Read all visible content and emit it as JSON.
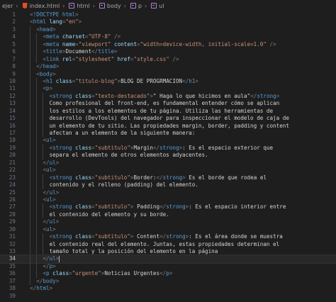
{
  "breadcrumb": {
    "items": [
      {
        "label": "ejer",
        "icon": "folder"
      },
      {
        "label": "index.html",
        "icon": "html-file-icon"
      },
      {
        "label": "html",
        "icon": "tag-icon"
      },
      {
        "label": "body",
        "icon": "tag-icon"
      },
      {
        "label": "p",
        "icon": "tag-icon"
      },
      {
        "label": "ul",
        "icon": "tag-icon"
      }
    ]
  },
  "editor": {
    "active_line": 34,
    "colors": {
      "tag": "#569cd6",
      "attr": "#9cdcfe",
      "string": "#ce9178",
      "text": "#d4d4d4",
      "punctuation": "#808080",
      "background": "#1e1e1e"
    },
    "lines": [
      {
        "n": "1",
        "indent": 1,
        "tokens": [
          [
            "p",
            "<"
          ],
          [
            "tag",
            "!DOCTYPE"
          ],
          [
            "tag",
            " html"
          ],
          [
            "p",
            ">"
          ]
        ]
      },
      {
        "n": "2",
        "indent": 1,
        "tokens": [
          [
            "p",
            "<"
          ],
          [
            "tag",
            "html"
          ],
          [
            "attr",
            " lang"
          ],
          [
            "p",
            "="
          ],
          [
            "str",
            "\"en\""
          ],
          [
            "p",
            ">"
          ]
        ]
      },
      {
        "n": "3",
        "indent": 2,
        "tokens": [
          [
            "p",
            "<"
          ],
          [
            "tag",
            "head"
          ],
          [
            "p",
            ">"
          ]
        ]
      },
      {
        "n": "4",
        "indent": 3,
        "tokens": [
          [
            "p",
            "<"
          ],
          [
            "tag",
            "meta"
          ],
          [
            "attr",
            " charset"
          ],
          [
            "p",
            "="
          ],
          [
            "str",
            "\"UTF-8\""
          ],
          [
            "p",
            " />"
          ]
        ]
      },
      {
        "n": "5",
        "indent": 3,
        "tokens": [
          [
            "p",
            "<"
          ],
          [
            "tag",
            "meta"
          ],
          [
            "attr",
            " name"
          ],
          [
            "p",
            "="
          ],
          [
            "str",
            "\"viewport\""
          ],
          [
            "attr",
            " content"
          ],
          [
            "p",
            "="
          ],
          [
            "str",
            "\"width=device-width, initial-scale=1.0\""
          ],
          [
            "p",
            " />"
          ]
        ]
      },
      {
        "n": "6",
        "indent": 3,
        "tokens": [
          [
            "p",
            "<"
          ],
          [
            "tag",
            "title"
          ],
          [
            "p",
            ">"
          ],
          [
            "text",
            "Document"
          ],
          [
            "p",
            "</"
          ],
          [
            "tag",
            "title"
          ],
          [
            "p",
            ">"
          ]
        ]
      },
      {
        "n": "7",
        "indent": 3,
        "tokens": [
          [
            "p",
            "<"
          ],
          [
            "tag",
            "link"
          ],
          [
            "attr",
            " rel"
          ],
          [
            "p",
            "="
          ],
          [
            "str",
            "\"stylesheet\""
          ],
          [
            "attr",
            " href"
          ],
          [
            "p",
            "="
          ],
          [
            "str",
            "\"style.css\""
          ],
          [
            "p",
            " />"
          ]
        ]
      },
      {
        "n": "8",
        "indent": 2,
        "tokens": [
          [
            "p",
            "</"
          ],
          [
            "tag",
            "head"
          ],
          [
            "p",
            ">"
          ]
        ]
      },
      {
        "n": "9",
        "indent": 2,
        "tokens": [
          [
            "p",
            "<"
          ],
          [
            "tag",
            "body"
          ],
          [
            "p",
            ">"
          ]
        ]
      },
      {
        "n": "10",
        "indent": 3,
        "tokens": [
          [
            "p",
            "<"
          ],
          [
            "tag",
            "h1"
          ],
          [
            "attr",
            " class"
          ],
          [
            "p",
            "="
          ],
          [
            "str",
            "\"titulo-blog\""
          ],
          [
            "p",
            ">"
          ],
          [
            "text",
            "BLOG DE PROGRMACION"
          ],
          [
            "p",
            "</"
          ],
          [
            "tag",
            "h1"
          ],
          [
            "p",
            ">"
          ]
        ]
      },
      {
        "n": "11",
        "indent": 3,
        "tokens": [
          [
            "p",
            "<"
          ],
          [
            "tag",
            "p"
          ],
          [
            "p",
            ">"
          ]
        ]
      },
      {
        "n": "12",
        "indent": 4,
        "tokens": [
          [
            "p",
            "<"
          ],
          [
            "tag",
            "strong"
          ],
          [
            "attr",
            " class"
          ],
          [
            "p",
            "="
          ],
          [
            "str",
            "\"texto-destacado\""
          ],
          [
            "p",
            ">"
          ],
          [
            "text",
            "\" Haga lo que hicimos en aula\""
          ],
          [
            "p",
            "</"
          ],
          [
            "tag",
            "strong"
          ],
          [
            "p",
            ">"
          ]
        ]
      },
      {
        "n": "13",
        "indent": 4,
        "tokens": [
          [
            "text",
            "Como profesional del front-end, es fundamental entender cómo se aplican"
          ]
        ]
      },
      {
        "n": "14",
        "indent": 4,
        "tokens": [
          [
            "text",
            "los estilos a los elementos de tu página. Utiliza las herramientas de"
          ]
        ]
      },
      {
        "n": "15",
        "indent": 4,
        "tokens": [
          [
            "text",
            "desarrollo (DevTools) del navegador para inspeccionar el modelo de caja de"
          ]
        ]
      },
      {
        "n": "16",
        "indent": 4,
        "tokens": [
          [
            "text",
            "un elemento de tu sitio. Las propiedades margin, border, padding y content"
          ]
        ]
      },
      {
        "n": "17",
        "indent": 4,
        "tokens": [
          [
            "text",
            "afectan a un elemento de la siguiente manera:"
          ]
        ]
      },
      {
        "n": "18",
        "indent": 3,
        "tokens": [
          [
            "p",
            "<"
          ],
          [
            "tag",
            "ul"
          ],
          [
            "p",
            ">"
          ]
        ]
      },
      {
        "n": "19",
        "indent": 4,
        "tokens": [
          [
            "p",
            "<"
          ],
          [
            "tag",
            "strong"
          ],
          [
            "attr",
            " class"
          ],
          [
            "p",
            "="
          ],
          [
            "str",
            "\"subtitulo\""
          ],
          [
            "p",
            ">"
          ],
          [
            "text",
            "Margin"
          ],
          [
            "p",
            "</"
          ],
          [
            "tag",
            "strong"
          ],
          [
            "p",
            ">"
          ],
          [
            "text",
            ": Es el espacio exterior que"
          ]
        ]
      },
      {
        "n": "20",
        "indent": 4,
        "tokens": [
          [
            "text",
            "separa el elemento de otros elementos adyacentes."
          ]
        ]
      },
      {
        "n": "21",
        "indent": 3,
        "tokens": [
          [
            "p",
            "</"
          ],
          [
            "tag",
            "ul"
          ],
          [
            "p",
            ">"
          ]
        ]
      },
      {
        "n": "22",
        "indent": 3,
        "tokens": [
          [
            "p",
            "<"
          ],
          [
            "tag",
            "ul"
          ],
          [
            "p",
            ">"
          ]
        ]
      },
      {
        "n": "23",
        "indent": 4,
        "tokens": [
          [
            "p",
            "<"
          ],
          [
            "tag",
            "strong"
          ],
          [
            "attr",
            " class"
          ],
          [
            "p",
            "="
          ],
          [
            "str",
            "\"subtitulo\""
          ],
          [
            "p",
            ">"
          ],
          [
            "text",
            "Border:"
          ],
          [
            "p",
            "</"
          ],
          [
            "tag",
            "strong"
          ],
          [
            "p",
            ">"
          ],
          [
            "text",
            " Es el borde que rodea el"
          ]
        ]
      },
      {
        "n": "24",
        "indent": 4,
        "tokens": [
          [
            "text",
            "contenido y el relleno (padding) del elemento."
          ]
        ]
      },
      {
        "n": "25",
        "indent": 3,
        "tokens": [
          [
            "p",
            "</"
          ],
          [
            "tag",
            "ul"
          ],
          [
            "p",
            ">"
          ]
        ]
      },
      {
        "n": "26",
        "indent": 3,
        "tokens": [
          [
            "p",
            "<"
          ],
          [
            "tag",
            "ul"
          ],
          [
            "p",
            ">"
          ]
        ]
      },
      {
        "n": "27",
        "indent": 4,
        "tokens": [
          [
            "p",
            "<"
          ],
          [
            "tag",
            "strong"
          ],
          [
            "attr",
            " class"
          ],
          [
            "p",
            "="
          ],
          [
            "str",
            "\"subtitulo\""
          ],
          [
            "p",
            ">"
          ],
          [
            "text",
            " Padding"
          ],
          [
            "p",
            "</"
          ],
          [
            "tag",
            "strong"
          ],
          [
            "p",
            ">"
          ],
          [
            "text",
            ": Es el espacio interior entre"
          ]
        ]
      },
      {
        "n": "28",
        "indent": 4,
        "tokens": [
          [
            "text",
            "el contenido del elemento y su borde."
          ]
        ]
      },
      {
        "n": "29",
        "indent": 3,
        "tokens": [
          [
            "p",
            "</"
          ],
          [
            "tag",
            "ul"
          ],
          [
            "p",
            ">"
          ]
        ]
      },
      {
        "n": "30",
        "indent": 3,
        "tokens": [
          [
            "p",
            "<"
          ],
          [
            "tag",
            "ul"
          ],
          [
            "p",
            ">"
          ]
        ]
      },
      {
        "n": "31",
        "indent": 4,
        "tokens": [
          [
            "p",
            "<"
          ],
          [
            "tag",
            "strong"
          ],
          [
            "attr",
            " class"
          ],
          [
            "p",
            "="
          ],
          [
            "str",
            "\"subtitulo\""
          ],
          [
            "p",
            ">"
          ],
          [
            "text",
            " Content"
          ],
          [
            "p",
            "</"
          ],
          [
            "tag",
            "strong"
          ],
          [
            "p",
            ">"
          ],
          [
            "text",
            ": Es el área donde se muestra"
          ]
        ]
      },
      {
        "n": "32",
        "indent": 4,
        "tokens": [
          [
            "text",
            "el contenido real del elemento. Juntas, estas propiedades determinan el"
          ]
        ]
      },
      {
        "n": "33",
        "indent": 4,
        "tokens": [
          [
            "text",
            "tamaño total y la posición del elemento en la página"
          ]
        ]
      },
      {
        "n": "34",
        "indent": 3,
        "tokens": [
          [
            "p",
            "</"
          ],
          [
            "tag",
            "ul"
          ],
          [
            "p",
            ">"
          ]
        ]
      },
      {
        "n": "35",
        "indent": 3,
        "tokens": [
          [
            "p",
            "</"
          ],
          [
            "tag",
            "p"
          ],
          [
            "p",
            ">"
          ]
        ]
      },
      {
        "n": "36",
        "indent": 3,
        "tokens": [
          [
            "p",
            "<"
          ],
          [
            "tag",
            "p"
          ],
          [
            "attr",
            " class"
          ],
          [
            "p",
            "="
          ],
          [
            "str",
            "\"urgente\""
          ],
          [
            "p",
            ">"
          ],
          [
            "text",
            "Noticias Urgentes"
          ],
          [
            "p",
            "</"
          ],
          [
            "tag",
            "p"
          ],
          [
            "p",
            ">"
          ]
        ]
      },
      {
        "n": "37",
        "indent": 2,
        "tokens": [
          [
            "p",
            "</"
          ],
          [
            "tag",
            "body"
          ],
          [
            "p",
            ">"
          ]
        ]
      },
      {
        "n": "38",
        "indent": 1,
        "tokens": [
          [
            "p",
            "</"
          ],
          [
            "tag",
            "html"
          ],
          [
            "p",
            ">"
          ]
        ]
      },
      {
        "n": "39",
        "indent": 0,
        "tokens": []
      }
    ]
  }
}
